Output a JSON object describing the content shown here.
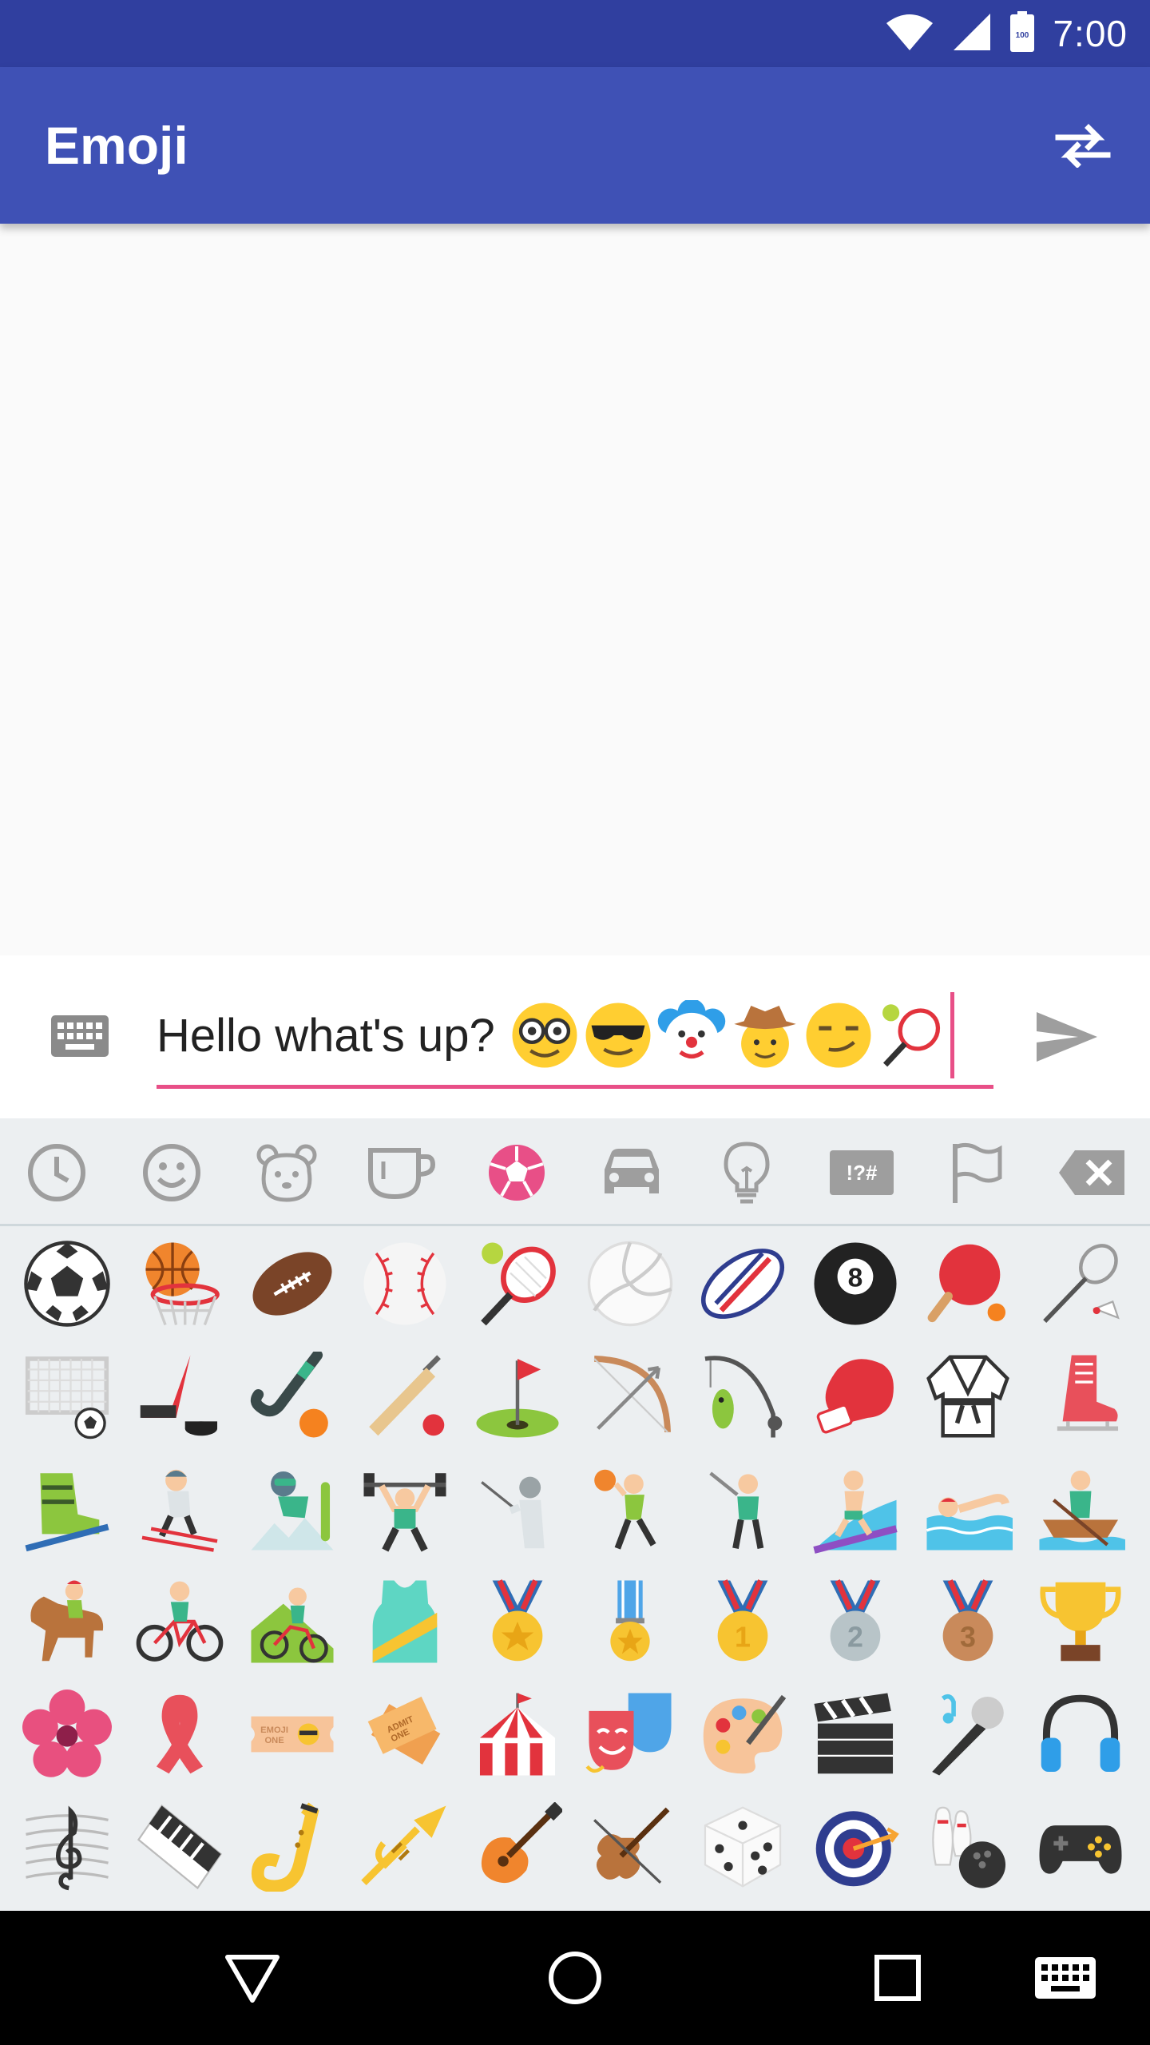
{
  "status_bar": {
    "time": "7:00",
    "battery_level": "100",
    "icons": [
      "wifi-icon",
      "cell-signal-icon",
      "battery-icon"
    ]
  },
  "app_bar": {
    "title": "Emoji",
    "action_icon": "swap-icon"
  },
  "input": {
    "text": "Hello what's up?",
    "inline_emoji": [
      "nerd-face",
      "sunglasses-face",
      "clown-face",
      "cowboy-face",
      "smirking-face",
      "tennis-racket"
    ],
    "keyboard_icon": "keyboard-icon",
    "send_icon": "send-icon"
  },
  "emoji_categories": [
    {
      "name": "recent",
      "icon": "clock-icon",
      "selected": false
    },
    {
      "name": "smileys",
      "icon": "smiley-icon",
      "selected": false
    },
    {
      "name": "animals",
      "icon": "bear-icon",
      "selected": false
    },
    {
      "name": "food",
      "icon": "cup-icon",
      "selected": false
    },
    {
      "name": "activities",
      "icon": "soccer-ball-icon",
      "selected": true
    },
    {
      "name": "travel",
      "icon": "car-icon",
      "selected": false
    },
    {
      "name": "objects",
      "icon": "lightbulb-icon",
      "selected": false
    },
    {
      "name": "symbols",
      "icon": "symbols-icon",
      "label": "!?#",
      "selected": false
    },
    {
      "name": "flags",
      "icon": "flag-icon",
      "selected": false
    },
    {
      "name": "backspace",
      "icon": "backspace-icon",
      "selected": false
    }
  ],
  "emoji_grid": [
    [
      "soccer-ball",
      "basketball-hoop",
      "american-football",
      "baseball",
      "tennis",
      "volleyball",
      "rugby-football",
      "pool-8-ball",
      "ping-pong",
      "badminton"
    ],
    [
      "goal-net",
      "ice-hockey",
      "field-hockey",
      "cricket",
      "golf-flag",
      "bow-and-arrow",
      "fishing-pole",
      "boxing-glove",
      "martial-arts-uniform",
      "ice-skate"
    ],
    [
      "ski-boot",
      "skier",
      "snowboarder",
      "weight-lifter",
      "fencer",
      "basketball-player",
      "golfer",
      "surfer",
      "swimmer",
      "rowboat"
    ],
    [
      "horse-racing",
      "bicyclist",
      "mountain-bicyclist",
      "running-shirt",
      "sports-medal",
      "military-medal",
      "gold-medal",
      "silver-medal",
      "bronze-medal",
      "trophy"
    ],
    [
      "rosette-flower",
      "reminder-ribbon",
      "admission-ticket",
      "ticket",
      "circus-tent",
      "performing-arts",
      "artist-palette",
      "clapper-board",
      "microphone",
      "headphones"
    ],
    [
      "musical-score",
      "musical-keyboard",
      "saxophone",
      "trumpet",
      "guitar",
      "violin",
      "game-die",
      "direct-hit",
      "bowling",
      "video-game"
    ]
  ],
  "colors": {
    "status_bar": "#303f9f",
    "app_bar": "#3f51b5",
    "accent": "#e84f87",
    "icon_grey": "#9e9e9e",
    "panel_bg": "#eceff1"
  },
  "nav_bar": {
    "buttons": [
      "back-icon",
      "home-icon",
      "recents-icon",
      "keyboard-icon"
    ]
  }
}
